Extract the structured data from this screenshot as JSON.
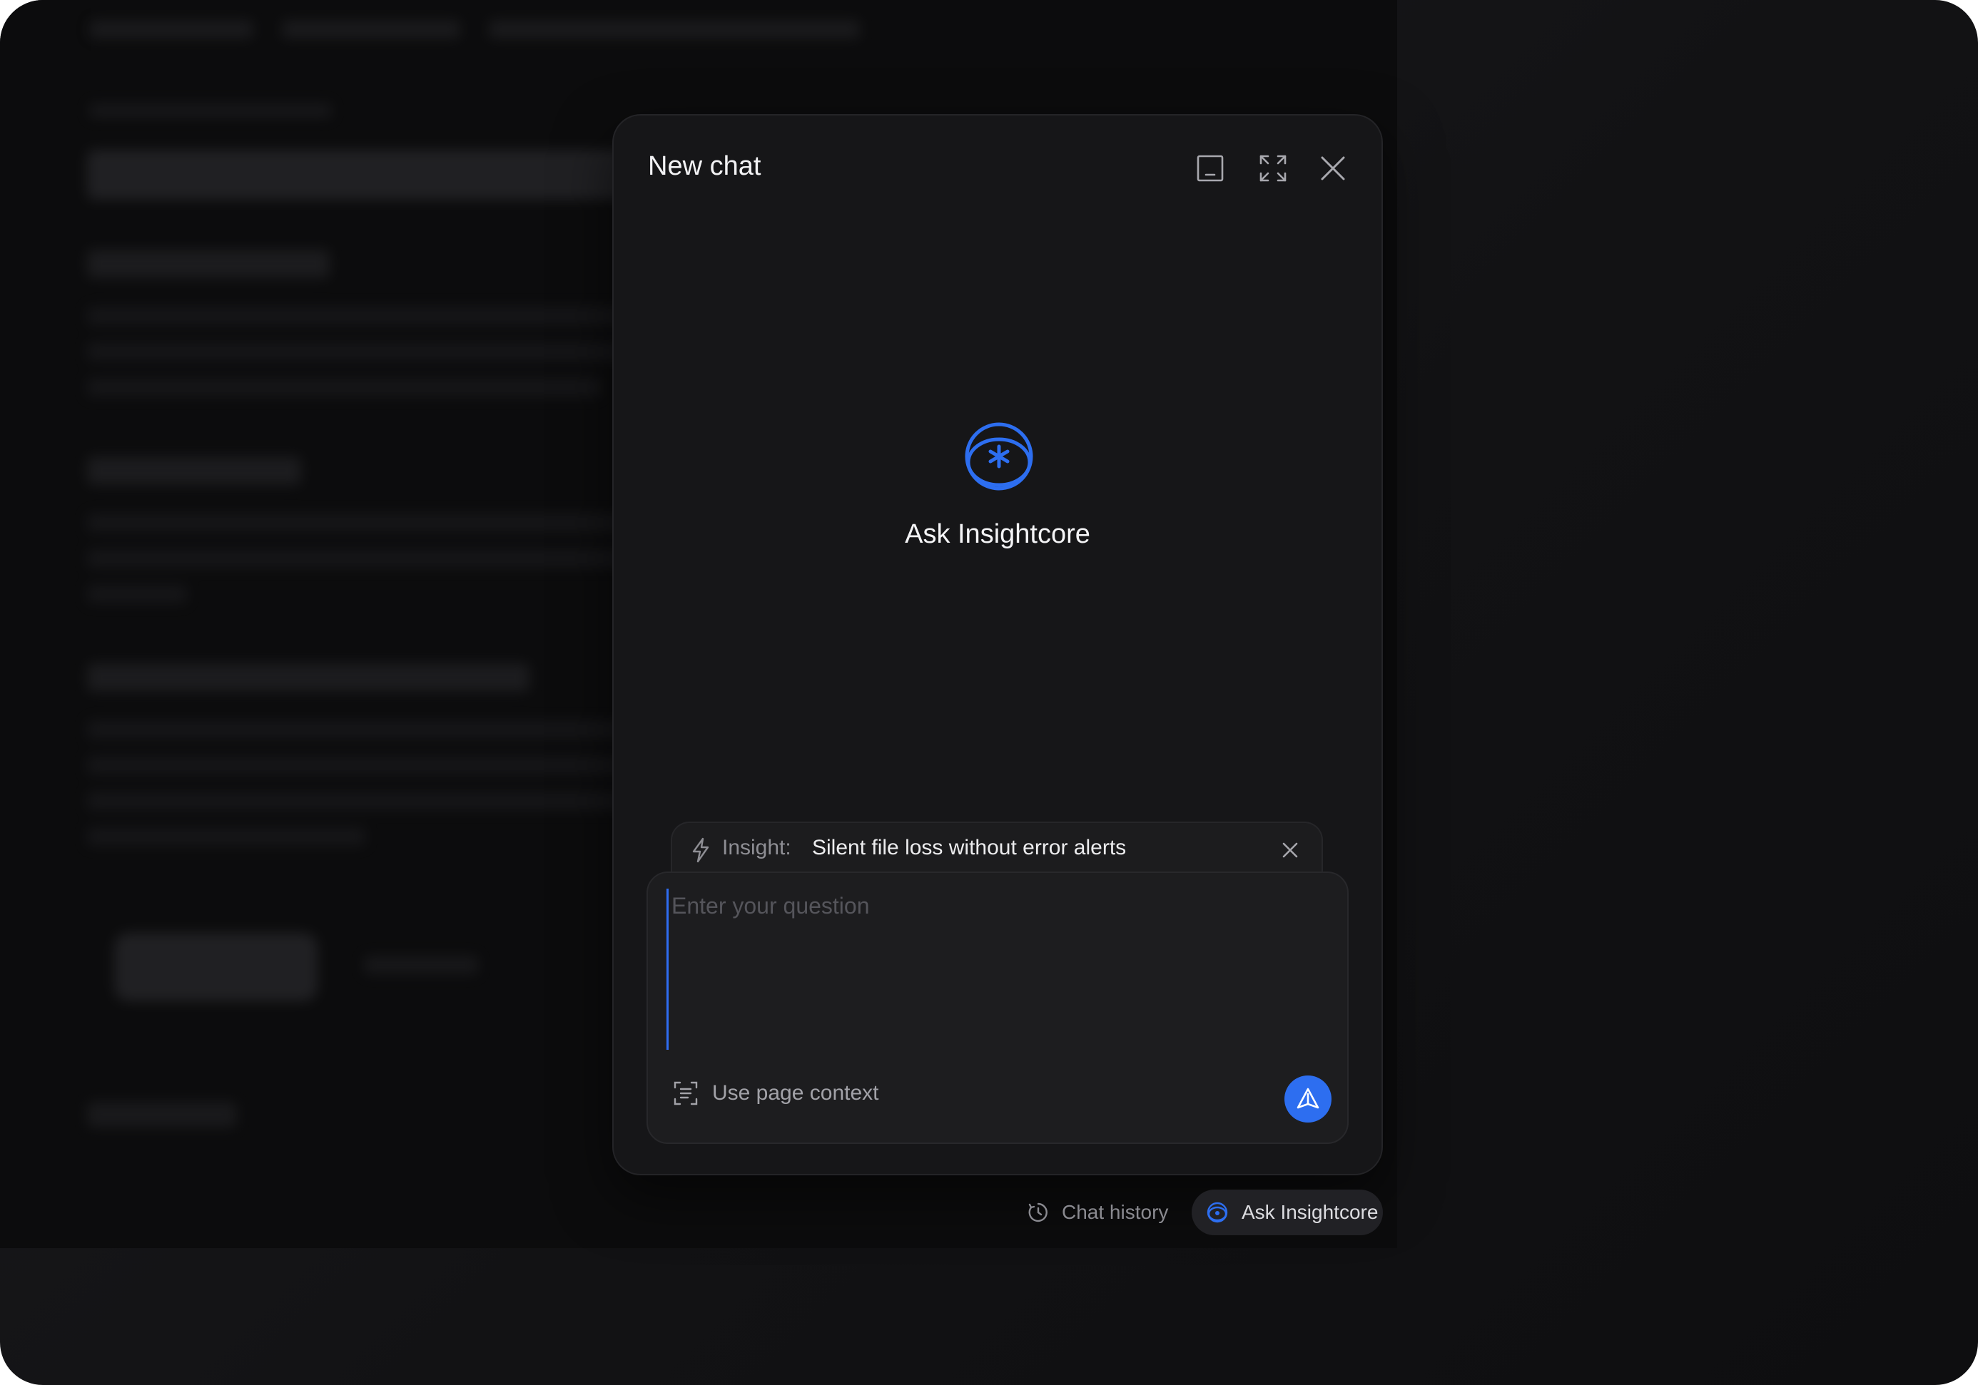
{
  "modal": {
    "title": "New chat",
    "minimize_icon": "minimize-icon",
    "expand_icon": "expand-icon",
    "close_icon": "close-icon"
  },
  "hero": {
    "label": "Ask Insightcore",
    "icon": "insightcore-logo-icon"
  },
  "insight": {
    "label": "Insight:",
    "value": "Silent file loss without error alerts"
  },
  "composer": {
    "placeholder": "Enter your question",
    "context_label": "Use page context"
  },
  "footer": {
    "history_label": "Chat history",
    "ask_label": "Ask Insightcore"
  },
  "colors": {
    "accent": "#2D6EF0",
    "modal_bg": "#161618",
    "page_bg": "#0C0C0D"
  }
}
